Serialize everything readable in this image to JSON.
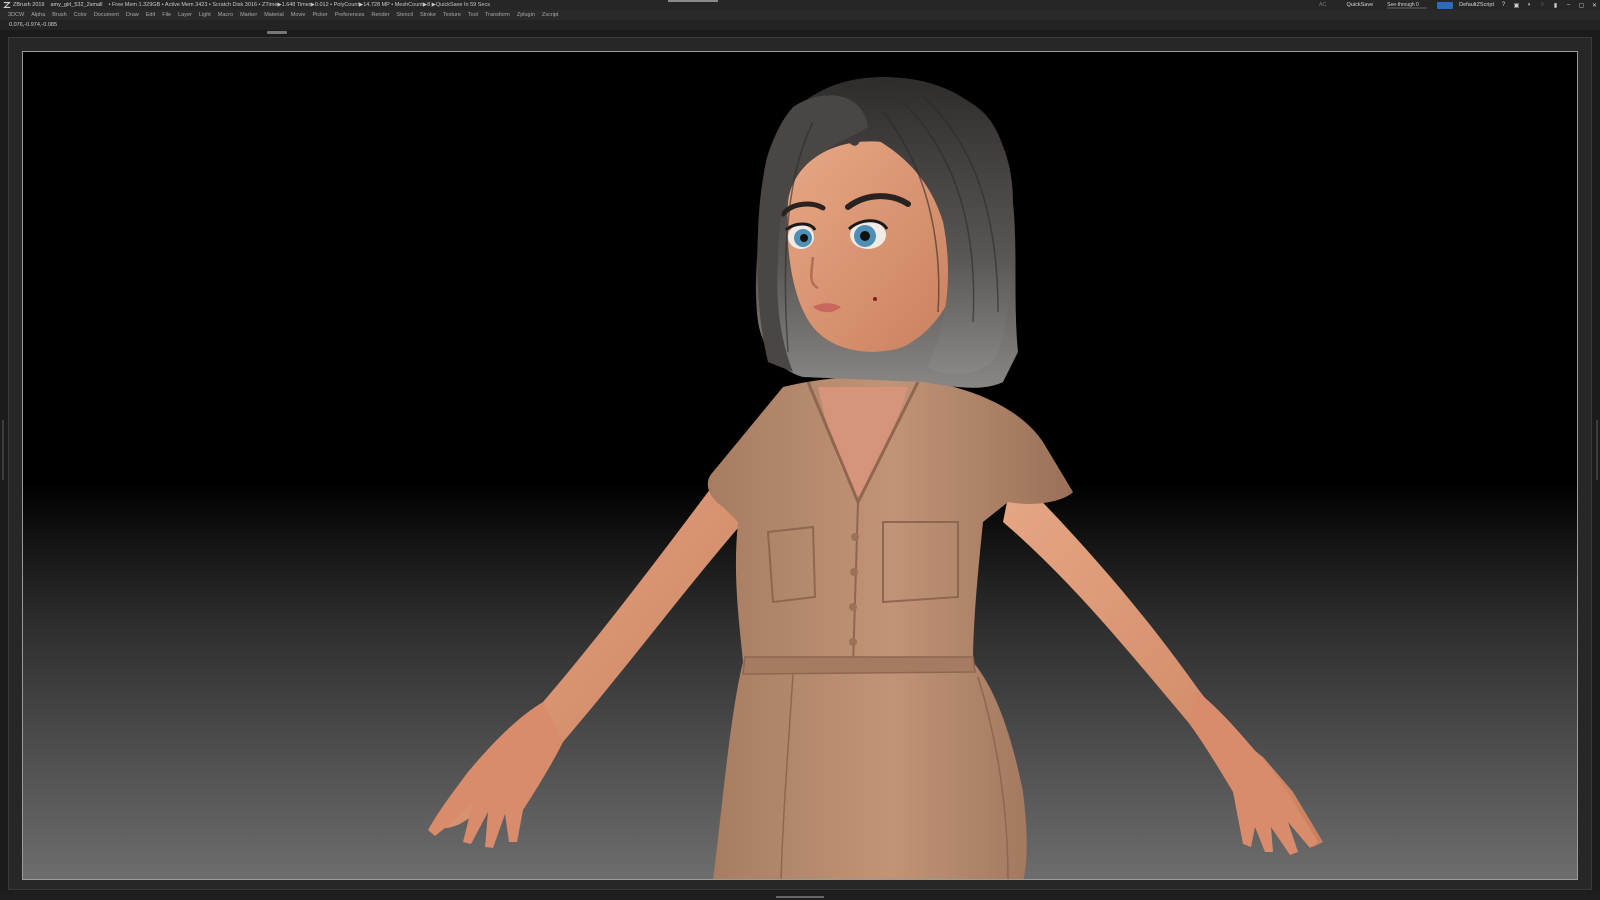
{
  "titlebar": {
    "app": "ZBrush 2019",
    "file": "amy_girl_532_2small",
    "stats": "• Free Mem 1.329GB • Active Mem 3423 • Scratch Disk 3016 • ZTime▶1.648 Timer▶0.012 • PolyCount▶14.728 MP • MeshCount▶8 ▶QuickSave In 59 Secs",
    "ac": "AC",
    "quicksave": "QuickSave",
    "seethrough": "See-through  0",
    "seethrough_value": 0,
    "script": "DefaultZScript",
    "accent_color": "#2d6bbf"
  },
  "menubar": {
    "items": [
      "3DCW",
      "Alpha",
      "Brush",
      "Color",
      "Document",
      "Draw",
      "Edit",
      "File",
      "Layer",
      "Light",
      "Macro",
      "Marker",
      "Material",
      "Movie",
      "Picker",
      "Preferences",
      "Render",
      "Stencil",
      "Stroke",
      "Texture",
      "Tool",
      "Transform",
      "Zplugin",
      "Zscript"
    ]
  },
  "infobar": {
    "coords": "0.076,-0.974,-0.085"
  },
  "canvas": {
    "subject": "3D sculpted cartoon girl model with shoulder-length dark hair and beige short-sleeve button dress in A-pose",
    "skin_color": "#d9906f",
    "dress_color": "#b5876a",
    "hair_color": "#5a5654",
    "eye_color": "#4f8fb5"
  }
}
